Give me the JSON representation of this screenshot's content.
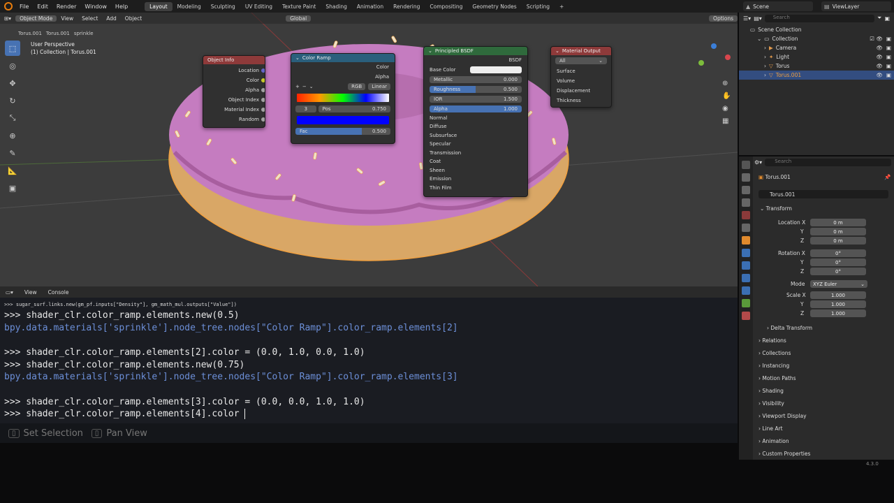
{
  "topbar": {
    "menus": [
      "File",
      "Edit",
      "Render",
      "Window",
      "Help"
    ],
    "workspaces": [
      "Layout",
      "Modeling",
      "Sculpting",
      "UV Editing",
      "Texture Paint",
      "Shading",
      "Animation",
      "Rendering",
      "Compositing",
      "Geometry Nodes",
      "Scripting"
    ],
    "active_workspace": "Layout",
    "add_tab": "+",
    "scene": "Scene",
    "view_layer": "ViewLayer"
  },
  "viewport": {
    "mode": "Object Mode",
    "menus": [
      "View",
      "Select",
      "Add",
      "Object"
    ],
    "transform": "Global",
    "options": "Options",
    "perspective": "User Perspective",
    "collection_info": "(1) Collection | Torus.001",
    "breadcrumb": [
      "Torus.001",
      "Torus.001",
      "sprinkle"
    ]
  },
  "nodes": {
    "object_info": {
      "title": "Object Info",
      "outputs": [
        "Location",
        "Color",
        "Alpha",
        "Object Index",
        "Material Index",
        "Random"
      ]
    },
    "color_ramp": {
      "title": "Color Ramp",
      "outputs": [
        "Color",
        "Alpha"
      ],
      "mode": "RGB",
      "interpolation": "Linear",
      "index": "3",
      "pos_label": "Pos",
      "pos_value": "0.750",
      "fac_label": "Fac",
      "fac_value": "0.500"
    },
    "bsdf": {
      "title": "Principled BSDF",
      "output": "BSDF",
      "base_color": "Base Color",
      "fields": [
        {
          "label": "Metallic",
          "value": "0.000"
        },
        {
          "label": "Roughness",
          "value": "0.500"
        },
        {
          "label": "IOR",
          "value": "1.500"
        },
        {
          "label": "Alpha",
          "value": "1.000"
        }
      ],
      "normal": "Normal",
      "panels": [
        "Diffuse",
        "Subsurface",
        "Specular",
        "Transmission",
        "Coat",
        "Sheen",
        "Emission",
        "Thin Film"
      ]
    },
    "material_output": {
      "title": "Material Output",
      "target": "All",
      "inputs": [
        "Surface",
        "Volume",
        "Displacement",
        "Thickness"
      ]
    }
  },
  "console": {
    "tabs": [
      "View",
      "Console"
    ],
    "lines": [
      ">>> sugar_surf.links.new(gm_pf.inputs[\"Density\"], gm_math_mul.outputs[\"Value\"])",
      ">>> shader_clr.color_ramp.elements.new(0.5)",
      "bpy.data.materials['sprinkle'].node_tree.nodes[\"Color Ramp\"].color_ramp.elements[2]",
      ">>> shader_clr.color_ramp.elements[2].color = (0.0, 1.0, 0.0, 1.0)",
      ">>> shader_clr.color_ramp.elements.new(0.75)",
      "bpy.data.materials['sprinkle'].node_tree.nodes[\"Color Ramp\"].color_ramp.elements[3]",
      ">>> shader_clr.color_ramp.elements[3].color = (0.0, 0.0, 1.0, 1.0)",
      ">>> shader_clr.color_ramp.elements[4].color "
    ]
  },
  "status": {
    "set_selection": "Set Selection",
    "pan_view": "Pan View"
  },
  "outliner": {
    "search_placeholder": "Search",
    "scene_collection": "Scene Collection",
    "items": [
      "Collection",
      "Camera",
      "Light",
      "Torus",
      "Torus.001"
    ]
  },
  "properties": {
    "search_placeholder": "Search",
    "object_name": "Torus.001",
    "object_field": "Torus.001",
    "transform": "Transform",
    "location_label": "Location X",
    "rotation_label": "Rotation X",
    "scale_label": "Scale X",
    "y": "Y",
    "z": "Z",
    "location": [
      "0 m",
      "0 m",
      "0 m"
    ],
    "rotation": [
      "0°",
      "0°",
      "0°"
    ],
    "mode_label": "Mode",
    "mode_value": "XYZ Euler",
    "scale": [
      "1.000",
      "1.000",
      "1.000"
    ],
    "delta": "Delta Transform",
    "panels": [
      "Relations",
      "Collections",
      "Instancing",
      "Motion Paths",
      "Shading",
      "Visibility",
      "Viewport Display",
      "Line Art",
      "Animation",
      "Custom Properties"
    ],
    "version": "4.3.0"
  },
  "colors": {
    "accent": "#4772b3",
    "selection": "#f0a040",
    "donut": "#c57cc0",
    "dough": "#d9a766"
  }
}
